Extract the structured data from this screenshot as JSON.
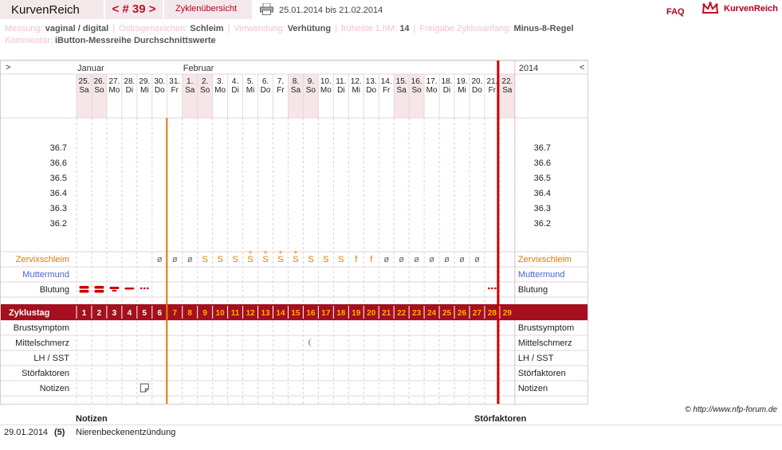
{
  "header": {
    "brand": "KurvenReich",
    "cycle_nav": "< # 39 >",
    "overview_tab": "Zyklenübersicht",
    "date_range": "25.01.2014 bis 21.02.2014",
    "faq": "FAQ",
    "logo_text": "KurvenReich"
  },
  "info": {
    "row1": [
      {
        "label": "Messung:",
        "value": "vaginal / digital"
      },
      {
        "label": "Östrogenzeichen:",
        "value": "Schleim"
      },
      {
        "label": "Verwendung:",
        "value": "Verhütung"
      },
      {
        "label": "früheste 1.hM:",
        "value": "14"
      },
      {
        "label": "Freigabe Zyklusanfang:",
        "value": "Minus-8-Regel"
      }
    ],
    "row2": [
      {
        "label": "Kommentar:",
        "value": "iButton-Messreihe Durchschnittswerte"
      }
    ]
  },
  "chart": {
    "left_arrow": ">",
    "right_arrow": "<",
    "year": "2014",
    "months": [
      {
        "label": "Januar",
        "col": 0
      },
      {
        "label": "Februar",
        "col": 7
      }
    ],
    "days": [
      {
        "d": "25.",
        "w": "Sa"
      },
      {
        "d": "26.",
        "w": "So"
      },
      {
        "d": "27.",
        "w": "Mo"
      },
      {
        "d": "28.",
        "w": "Di"
      },
      {
        "d": "29.",
        "w": "Mi"
      },
      {
        "d": "30.",
        "w": "Do"
      },
      {
        "d": "31.",
        "w": "Fr"
      },
      {
        "d": "1.",
        "w": "Sa"
      },
      {
        "d": "2.",
        "w": "So"
      },
      {
        "d": "3.",
        "w": "Mo"
      },
      {
        "d": "4.",
        "w": "Di"
      },
      {
        "d": "5.",
        "w": "Mi"
      },
      {
        "d": "6.",
        "w": "Do"
      },
      {
        "d": "7.",
        "w": "Fr"
      },
      {
        "d": "8.",
        "w": "Sa"
      },
      {
        "d": "9.",
        "w": "So"
      },
      {
        "d": "10.",
        "w": "Mo"
      },
      {
        "d": "11.",
        "w": "Di"
      },
      {
        "d": "12.",
        "w": "Mi"
      },
      {
        "d": "13.",
        "w": "Do"
      },
      {
        "d": "14.",
        "w": "Fr"
      },
      {
        "d": "15.",
        "w": "Sa"
      },
      {
        "d": "16.",
        "w": "So"
      },
      {
        "d": "17.",
        "w": "Mo"
      },
      {
        "d": "18.",
        "w": "Di"
      },
      {
        "d": "19.",
        "w": "Mi"
      },
      {
        "d": "20.",
        "w": "Do"
      },
      {
        "d": "21.",
        "w": "Fr"
      },
      {
        "d": "22.",
        "w": "Sa"
      }
    ],
    "temp_ticks": [
      "36.7",
      "36.6",
      "36.5",
      "36.4",
      "36.3",
      "36.2"
    ],
    "rows_top": {
      "zervix": "Zervixschleim",
      "muttermund": "Muttermund",
      "blutung": "Blutung"
    },
    "zyklustag_label": "Zyklustag",
    "zyklustage": [
      "1",
      "2",
      "3",
      "4",
      "5",
      "6",
      "7",
      "8",
      "9",
      "10",
      "11",
      "12",
      "13",
      "14",
      "15",
      "16",
      "17",
      "18",
      "19",
      "20",
      "21",
      "22",
      "23",
      "24",
      "25",
      "26",
      "27",
      "28",
      "29"
    ],
    "zervix_values": [
      "",
      "",
      "",
      "",
      "",
      "ø",
      "ø",
      "ø",
      "S",
      "S",
      "S",
      "S+",
      "S+",
      "S+",
      "S+",
      "S",
      "S",
      "S",
      "f",
      "f",
      "ø",
      "ø",
      "ø",
      "ø",
      "ø",
      "ø",
      "ø",
      "",
      ""
    ],
    "blutung_values": [
      "heavy",
      "heavy",
      "medium",
      "light",
      "spotting",
      "",
      "",
      "",
      "",
      "",
      "",
      "",
      "",
      "",
      "",
      "",
      "",
      "",
      "",
      "",
      "",
      "",
      "",
      "",
      "",
      "",
      "",
      "spotting",
      ""
    ],
    "rows_bottom": [
      "Brustsymptom",
      "Mittelschmerz",
      "LH / SST",
      "Störfaktoren",
      "Notizen"
    ],
    "mittelschmerz_day_index": 15,
    "notiz_day_index": 4,
    "colors": {
      "zyklustag_bg": "#a50f1e",
      "accent_orange": "#e07b00",
      "cycle_end_line": "#cc0000",
      "weekend_bg": "#f6e6e8",
      "blood": "#cc0000",
      "muttermund": "#4a63d1"
    }
  },
  "footer": {
    "copyright": "© http://www.nfp-forum.de",
    "notes_header": "Notizen",
    "stoer_header": "Störfaktoren",
    "notes": [
      {
        "date": "29.01.2014",
        "day": "(5)",
        "text": "Nierenbeckenentzündung"
      }
    ]
  }
}
